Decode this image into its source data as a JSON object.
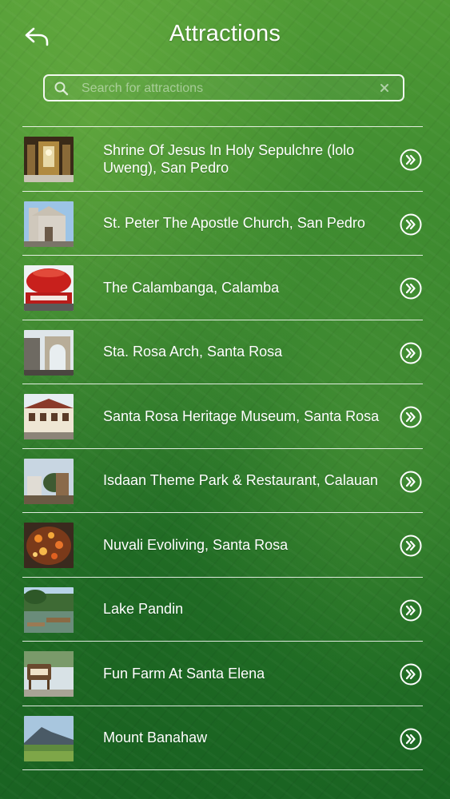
{
  "header": {
    "title": "Attractions",
    "back_icon": "back-arrow-icon"
  },
  "search": {
    "placeholder": "Search for attractions",
    "value": "",
    "search_icon": "search-icon",
    "clear_icon": "clear-icon"
  },
  "attractions": [
    {
      "label": "Shrine Of Jesus In Holy Sepulchre (lolo Uweng), San Pedro",
      "thumb_icon": "shrine-photo"
    },
    {
      "label": "St. Peter The Apostle Church, San Pedro",
      "thumb_icon": "church-photo"
    },
    {
      "label": "The Calambanga, Calamba",
      "thumb_icon": "calambanga-photo"
    },
    {
      "label": "Sta. Rosa Arch, Santa Rosa",
      "thumb_icon": "arch-photo"
    },
    {
      "label": "Santa Rosa Heritage Museum, Santa Rosa",
      "thumb_icon": "museum-photo"
    },
    {
      "label": "Isdaan Theme Park & Restaurant, Calauan",
      "thumb_icon": "theme-park-photo"
    },
    {
      "label": "Nuvali Evoliving, Santa Rosa",
      "thumb_icon": "koi-pond-photo"
    },
    {
      "label": "Lake Pandin",
      "thumb_icon": "lake-photo"
    },
    {
      "label": "Fun Farm At Santa Elena",
      "thumb_icon": "farm-photo"
    },
    {
      "label": "Mount Banahaw",
      "thumb_icon": "mountain-photo"
    }
  ],
  "row_action_icon": "chevron-right-circle-icon"
}
